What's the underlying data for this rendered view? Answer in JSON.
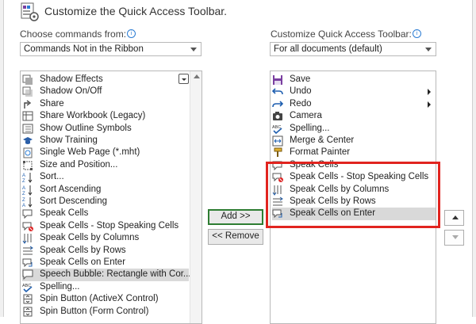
{
  "title": "Customize the Quick Access Toolbar.",
  "left": {
    "label": "Choose commands from:",
    "dropdown_value": "Commands Not in the Ribbon",
    "items": [
      {
        "label": "Shadow Effects",
        "icon": "shadow-effects-icon"
      },
      {
        "label": "Shadow On/Off",
        "icon": "shadow-onoff-icon"
      },
      {
        "label": "Share",
        "icon": "share-icon"
      },
      {
        "label": "Share Workbook (Legacy)",
        "icon": "share-workbook-icon"
      },
      {
        "label": "Show Outline Symbols",
        "icon": "outline-symbols-icon"
      },
      {
        "label": "Show Training",
        "icon": "training-icon"
      },
      {
        "label": "Single Web Page (*.mht)",
        "icon": "web-page-icon"
      },
      {
        "label": "Size and Position...",
        "icon": "size-position-icon"
      },
      {
        "label": "Sort...",
        "icon": "sort-icon"
      },
      {
        "label": "Sort Ascending",
        "icon": "sort-ascending-icon"
      },
      {
        "label": "Sort Descending",
        "icon": "sort-descending-icon"
      },
      {
        "label": "Speak Cells",
        "icon": "speak-cells-icon"
      },
      {
        "label": "Speak Cells - Stop Speaking Cells",
        "icon": "stop-speaking-icon"
      },
      {
        "label": "Speak Cells by Columns",
        "icon": "speak-columns-icon"
      },
      {
        "label": "Speak Cells by Rows",
        "icon": "speak-rows-icon"
      },
      {
        "label": "Speak Cells on Enter",
        "icon": "speak-enter-icon"
      },
      {
        "label": "Speech Bubble: Rectangle with Cor...",
        "icon": "speech-bubble-icon",
        "selected": true
      },
      {
        "label": "Spelling...",
        "icon": "spelling-icon"
      },
      {
        "label": "Spin Button (ActiveX Control)",
        "icon": "spin-activex-icon"
      },
      {
        "label": "Spin Button (Form Control)",
        "icon": "spin-form-icon"
      }
    ]
  },
  "right": {
    "label": "Customize Quick Access Toolbar:",
    "dropdown_value": "For all documents (default)",
    "items": [
      {
        "label": "Save",
        "icon": "save-icon"
      },
      {
        "label": "Undo",
        "icon": "undo-icon",
        "flyout": true
      },
      {
        "label": "Redo",
        "icon": "redo-icon",
        "flyout": true
      },
      {
        "label": "Camera",
        "icon": "camera-icon"
      },
      {
        "label": "Spelling...",
        "icon": "spelling-icon"
      },
      {
        "label": "Merge & Center",
        "icon": "merge-center-icon"
      },
      {
        "label": "Format Painter",
        "icon": "format-painter-icon"
      },
      {
        "label": "Speak Cells",
        "icon": "speak-cells-icon"
      },
      {
        "label": "Speak Cells - Stop Speaking Cells",
        "icon": "stop-speaking-icon"
      },
      {
        "label": "Speak Cells by Columns",
        "icon": "speak-columns-icon"
      },
      {
        "label": "Speak Cells by Rows",
        "icon": "speak-rows-icon"
      },
      {
        "label": "Speak Cells on Enter",
        "icon": "speak-enter-icon",
        "selected": true
      }
    ]
  },
  "buttons": {
    "add": "Add >>",
    "remove": "<< Remove"
  },
  "colors": {
    "highlight": "#e1241f",
    "default_button_border": "#2e7d32",
    "selection": "#d9d9d9"
  }
}
